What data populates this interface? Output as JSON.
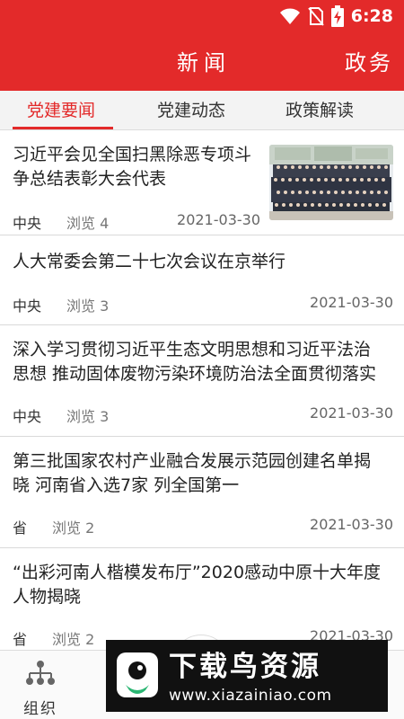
{
  "status": {
    "time": "6:28"
  },
  "nav": {
    "title_left": "新闻",
    "title_right": "政务"
  },
  "tabs": [
    {
      "label": "党建要闻",
      "active": true
    },
    {
      "label": "党建动态",
      "active": false
    },
    {
      "label": "政策解读",
      "active": false
    }
  ],
  "news": [
    {
      "title_line1": "习近平会见全国扫黑除恶专项斗",
      "title_line2": "争总结表彰大会代表",
      "source": "中央",
      "views": "浏览 4",
      "date": "2021-03-30"
    },
    {
      "title_line1": "人大常委会第二十七次会议在京举行",
      "source": "中央",
      "views": "浏览 3",
      "date": "2021-03-30"
    },
    {
      "title_line1": "深入学习贯彻习近平生态文明思想和习近平法治",
      "title_line2": "思想 推动固体废物污染环境防治法全面贯彻落实",
      "source": "中央",
      "views": "浏览 3",
      "date": "2021-03-30"
    },
    {
      "title_line1": "第三批国家农村产业融合发展示范园创建名单揭",
      "title_line2": "晓 河南省入选7家 列全国第一",
      "source": "省",
      "views": "浏览 2",
      "date": "2021-03-30"
    },
    {
      "title_line1": "“出彩河南人楷模发布厅”2020感动中原十大年度",
      "title_line2": "人物揭晓",
      "source": "省",
      "views": "浏览 2",
      "date": "2021-03-30"
    }
  ],
  "bottom_nav": {
    "org_label": "组织"
  },
  "watermark": {
    "text": "下载鸟资源",
    "url": "www.xiazainiao.com"
  },
  "colors": {
    "accent": "#e32a2a"
  }
}
